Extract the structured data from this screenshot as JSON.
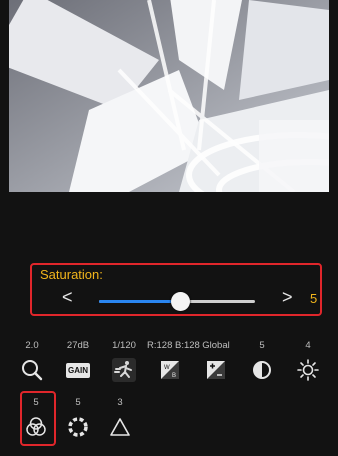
{
  "preview": {
    "image": "shuttlecock-closeup"
  },
  "saturation": {
    "label": "Saturation:",
    "value": "5",
    "level_fraction": 0.52,
    "prev_glyph": "<",
    "next_glyph": ">"
  },
  "toolbar_row1": [
    {
      "value": "2.0",
      "icon": "zoom-icon"
    },
    {
      "value": "27dB",
      "icon": "gain-icon",
      "badge": "GAIN"
    },
    {
      "value": "1/120",
      "icon": "shutter-speed-icon"
    },
    {
      "value": "R:128 B:128",
      "icon": "white-balance-icon"
    },
    {
      "value": "Global",
      "icon": "exposure-icon"
    },
    {
      "value": "5",
      "icon": "contrast-icon"
    },
    {
      "value": "4",
      "icon": "brightness-icon"
    }
  ],
  "toolbar_row2": [
    {
      "value": "5",
      "icon": "saturation-icon"
    },
    {
      "value": "5",
      "icon": "sharpness-icon"
    },
    {
      "value": "3",
      "icon": "gamma-icon"
    }
  ],
  "colors": {
    "accent": "#f1b51c",
    "highlight": "#e0262b",
    "slider": "#2a86f0"
  }
}
